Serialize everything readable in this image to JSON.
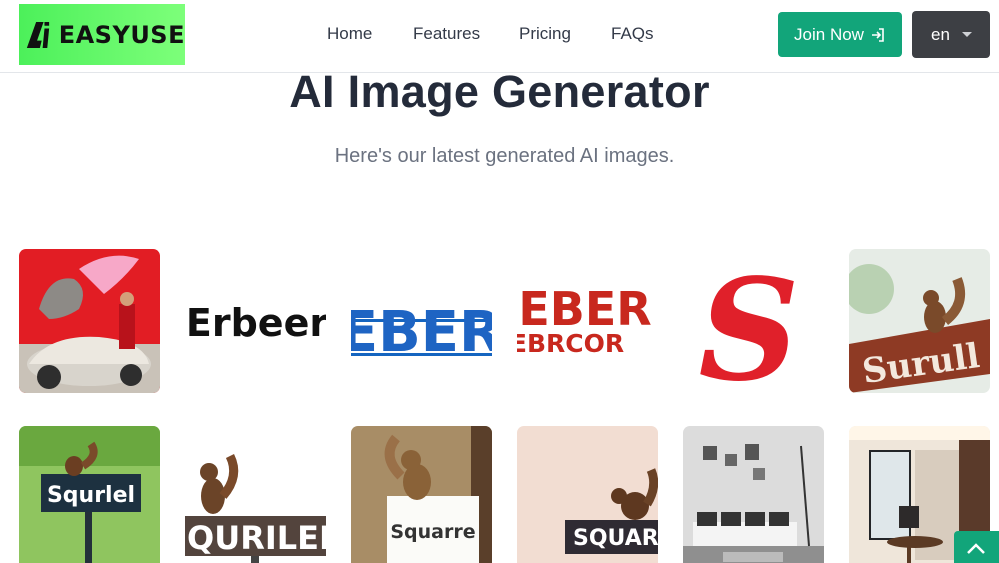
{
  "header": {
    "logo_text": "EASYUSE",
    "logo_mark": "AI",
    "nav": [
      "Home",
      "Features",
      "Pricing",
      "FAQs"
    ],
    "join_label": "Join Now",
    "lang_label": "en"
  },
  "hero": {
    "title": "AI Image Generator",
    "subtitle": "Here's our latest generated AI images."
  },
  "gallery": {
    "row1": [
      {
        "name": "pegasus-car"
      },
      {
        "text": "Erbeer"
      },
      {
        "text": "EBER"
      },
      {
        "text_top": "EBER",
        "text_bottom": "EBRCOR"
      },
      {
        "text": "S"
      },
      {
        "text": "Surull"
      }
    ],
    "row2": [
      {
        "text": "Squrlel"
      },
      {
        "text": "QURILEI"
      },
      {
        "text": "Squarre"
      },
      {
        "text": "SQUARL"
      },
      {
        "name": "living-room"
      },
      {
        "name": "bedroom"
      }
    ]
  },
  "colors": {
    "accent": "#12a57a",
    "logo_green": "#4cf05a",
    "lang_bg": "#3d3f44",
    "title": "#242b3a",
    "subtitle": "#6b7280"
  }
}
